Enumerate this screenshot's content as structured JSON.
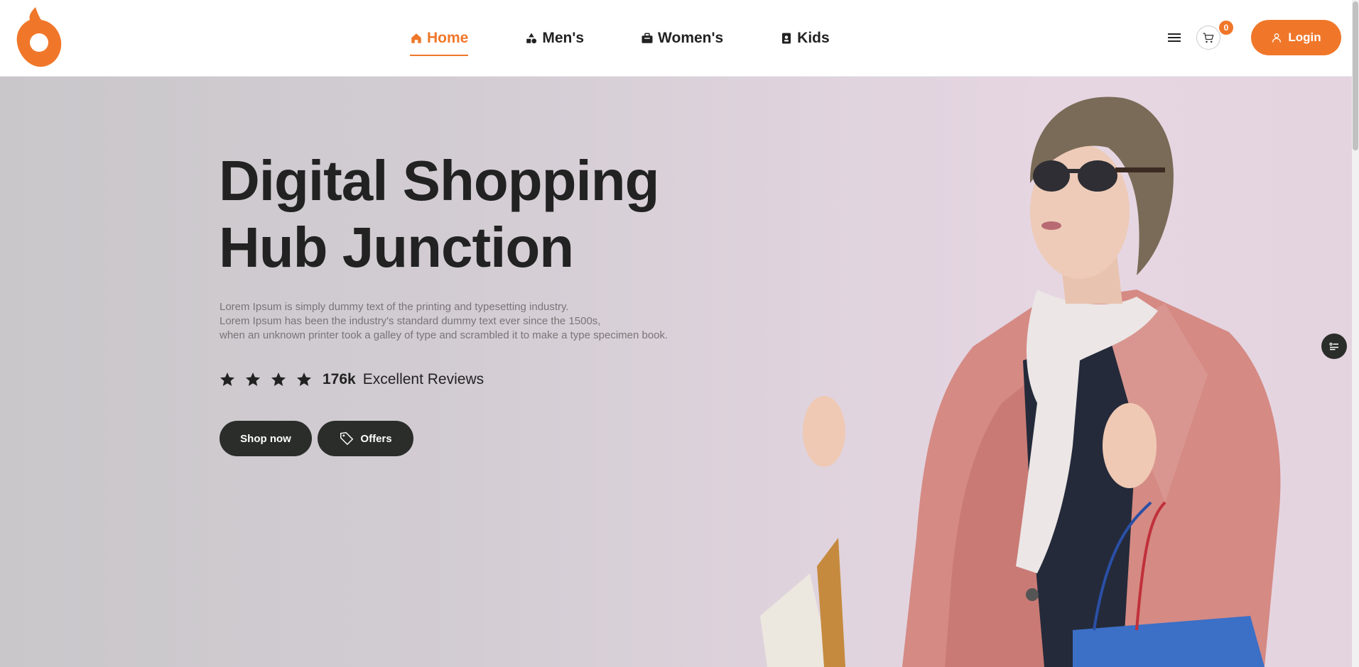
{
  "brand": {
    "logo_icon": "origin-logo",
    "accent": "#f0772a"
  },
  "nav": {
    "items": [
      {
        "label": "Home",
        "icon": "home-icon",
        "active": true
      },
      {
        "label": "Men's",
        "icon": "shapes-icon",
        "active": false
      },
      {
        "label": "Women's",
        "icon": "briefcase-icon",
        "active": false
      },
      {
        "label": "Kids",
        "icon": "id-badge-icon",
        "active": false
      }
    ]
  },
  "header": {
    "menu_icon": "hamburger-icon",
    "cart_icon": "cart-icon",
    "cart_count": "0",
    "login_label": "Login",
    "login_icon": "user-icon"
  },
  "hero": {
    "title_line1": "Digital Shopping",
    "title_line2": "Hub Junction",
    "desc_line1": "Lorem Ipsum is simply dummy text of the printing and typesetting industry.",
    "desc_line2": "Lorem Ipsum has been the industry's standard dummy text ever since the 1500s,",
    "desc_line3": "when an unknown printer took a galley of type and scrambled it to make a type specimen book.",
    "rating_stars": 4,
    "rating_count": "176k",
    "rating_text": "Excellent Reviews",
    "shop_label": "Shop now",
    "offers_label": "Offers",
    "offers_icon": "tag-icon"
  },
  "widget": {
    "icon": "filter-list-icon"
  }
}
